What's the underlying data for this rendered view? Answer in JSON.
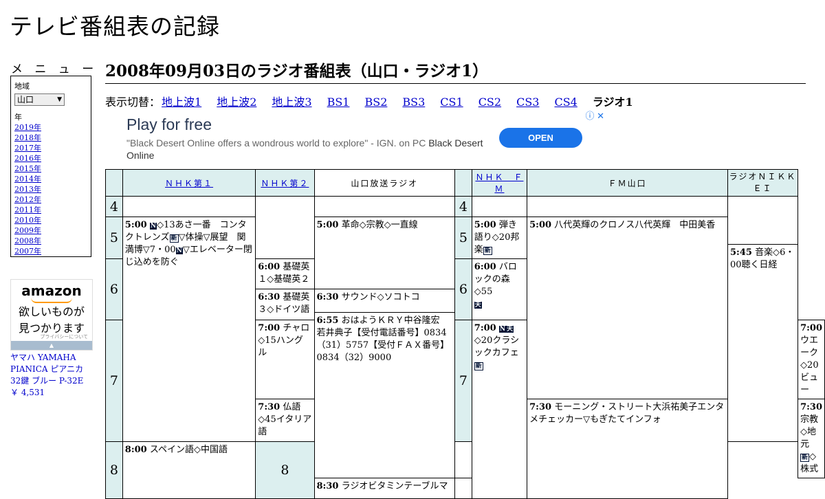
{
  "site_title": "テレビ番組表の記録",
  "menu": {
    "label": "メ ニ ュ ー",
    "region_label": "地域",
    "region_value": "山口",
    "year_label": "年",
    "years": [
      "2019年",
      "2018年",
      "2017年",
      "2016年",
      "2015年",
      "2014年",
      "2013年",
      "2012年",
      "2011年",
      "2010年",
      "2009年",
      "2008年",
      "2007年"
    ]
  },
  "amazon_ad": {
    "logo": "amazon",
    "tagline_1": "欲しいものが",
    "tagline_2": "見つかります",
    "privacy": "プライバシーについて",
    "product_name": "ヤマハ YAMAHA PIANICA ピアニカ 32鍵 ブルー P-32E",
    "price": "￥ 4,531"
  },
  "heading": "2008年09月03日のラジオ番組表（山口・ラジオ1）",
  "switcher": {
    "lead": "表示切替：",
    "links": [
      "地上波1",
      "地上波2",
      "地上波3",
      "BS1",
      "BS2",
      "BS3",
      "CS1",
      "CS2",
      "CS3",
      "CS4"
    ],
    "current": "ラジオ1"
  },
  "ad_banner": {
    "title": "Play for free",
    "desc": "\"Black Desert Online offers a wondrous world to explore\" - IGN. on PC",
    "advertiser": "Black Desert Online",
    "cta": "OPEN"
  },
  "channels": {
    "nhk1": "ＮＨＫ第１",
    "nhk2": "ＮＨＫ第２",
    "kry": "山口放送ラジオ",
    "nhkfm": "ＮＨＫ　ＦＭ",
    "fmy": "ＦＭ山口",
    "nikkei": "ラジオＮＩＫＫＥＩ"
  },
  "hours": {
    "h4": "4",
    "h5": "5",
    "h6": "6",
    "h7": "7",
    "h8": "8"
  },
  "programs": {
    "nhk1_500": {
      "time": "5:00",
      "pre": "",
      "title": "◇13あさ一番　コンタクトレンズ",
      "mid": "▽体操▽展望　関満博▽7・00",
      "post": "▽エレベーター閉じ込めを防ぐ"
    },
    "nhk1_830": {
      "time": "8:30",
      "title": "ラジオビタミンテーブルマ"
    },
    "nhk2_600": {
      "time": "6:00",
      "title": "基礎英１◇基礎英２"
    },
    "nhk2_630": {
      "time": "6:30",
      "title": "基礎英３◇ドイツ語"
    },
    "nhk2_700": {
      "time": "7:00",
      "title": "チャロ◇15ハングル"
    },
    "nhk2_730": {
      "time": "7:30",
      "title": "仏語◇45イタリア語"
    },
    "nhk2_800": {
      "time": "8:00",
      "title": "スペイン語◇中国語"
    },
    "kry_500": {
      "time": "5:00",
      "title": "革命◇宗教◇一直線"
    },
    "kry_630": {
      "time": "6:30",
      "title": "サウンド◇ソコトコ"
    },
    "kry_655": {
      "time": "6:55",
      "title": "おはようＫＲＹ中谷隆宏　若井典子【受付電話番号】0834（31）5757【受付ＦＡＸ番号】0834（32）9000"
    },
    "fm_500": {
      "time": "5:00",
      "title": "弾き語り◇20邦楽"
    },
    "fm_600": {
      "time": "6:00",
      "title": "バロックの森◇55"
    },
    "fm_700": {
      "time": "7:00",
      "title": "◇20クラシックカフェ"
    },
    "fmy_500": {
      "time": "5:00",
      "title": "八代英輝のクロノス八代英輝　中田美香"
    },
    "fmy_700": {
      "time": "7:00",
      "title": "ウエーク◇20ビュー"
    },
    "fmy_730": {
      "time": "7:30",
      "title": "モーニング・ストリート大浜祐美子エンタメチェッカー▽もぎたてインフォ"
    },
    "nk_545": {
      "time": "5:45",
      "title": "音楽◇6・00聴く日経"
    },
    "nk_730": {
      "time": "7:30",
      "title": "宗教◇地元",
      "post": "◇株式"
    }
  },
  "badges": {
    "news": "N",
    "weather": "天",
    "new": "新"
  }
}
